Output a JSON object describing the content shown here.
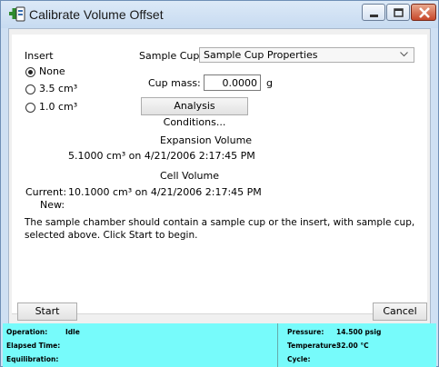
{
  "window": {
    "title": "Calibrate Volume Offset"
  },
  "insert": {
    "label": "Insert",
    "options": [
      {
        "label": "None",
        "checked": true
      },
      {
        "label": "3.5 cm³",
        "checked": false
      },
      {
        "label": "1.0 cm³",
        "checked": false
      }
    ]
  },
  "sample_cup": {
    "label": "Sample Cup",
    "selected": "Sample Cup Properties",
    "mass_label": "Cup mass:",
    "mass_value": "0.0000",
    "mass_unit": "g",
    "analysis_button": "Analysis Conditions..."
  },
  "expansion_volume": {
    "heading": "Expansion Volume",
    "value": "5.1000 cm³ on 4/21/2006 2:17:45 PM"
  },
  "cell_volume": {
    "heading": "Cell Volume",
    "current_label": "Current:",
    "current_value": "10.1000 cm³ on 4/21/2006 2:17:45 PM",
    "new_label": "New:"
  },
  "instructions": {
    "line1": "The sample chamber should contain a sample cup or the insert, with sample cup,",
    "line2": "selected above. Click Start to begin."
  },
  "buttons": {
    "start": "Start",
    "cancel": "Cancel"
  },
  "status": {
    "operation_label": "Operation:",
    "operation_value": "Idle",
    "elapsed_label": "Elapsed Time:",
    "equilibration_label": "Equilibration:",
    "pressure_label": "Pressure:",
    "pressure_value": "14.500 psig",
    "temperature_label": "Temperature:",
    "temperature_value": "32.00 °C",
    "cycle_label": "Cycle:"
  },
  "colors": {
    "status_bar": "#77fbfb",
    "title_bar": "#cfe0f3",
    "close_button": "#c7472a"
  }
}
